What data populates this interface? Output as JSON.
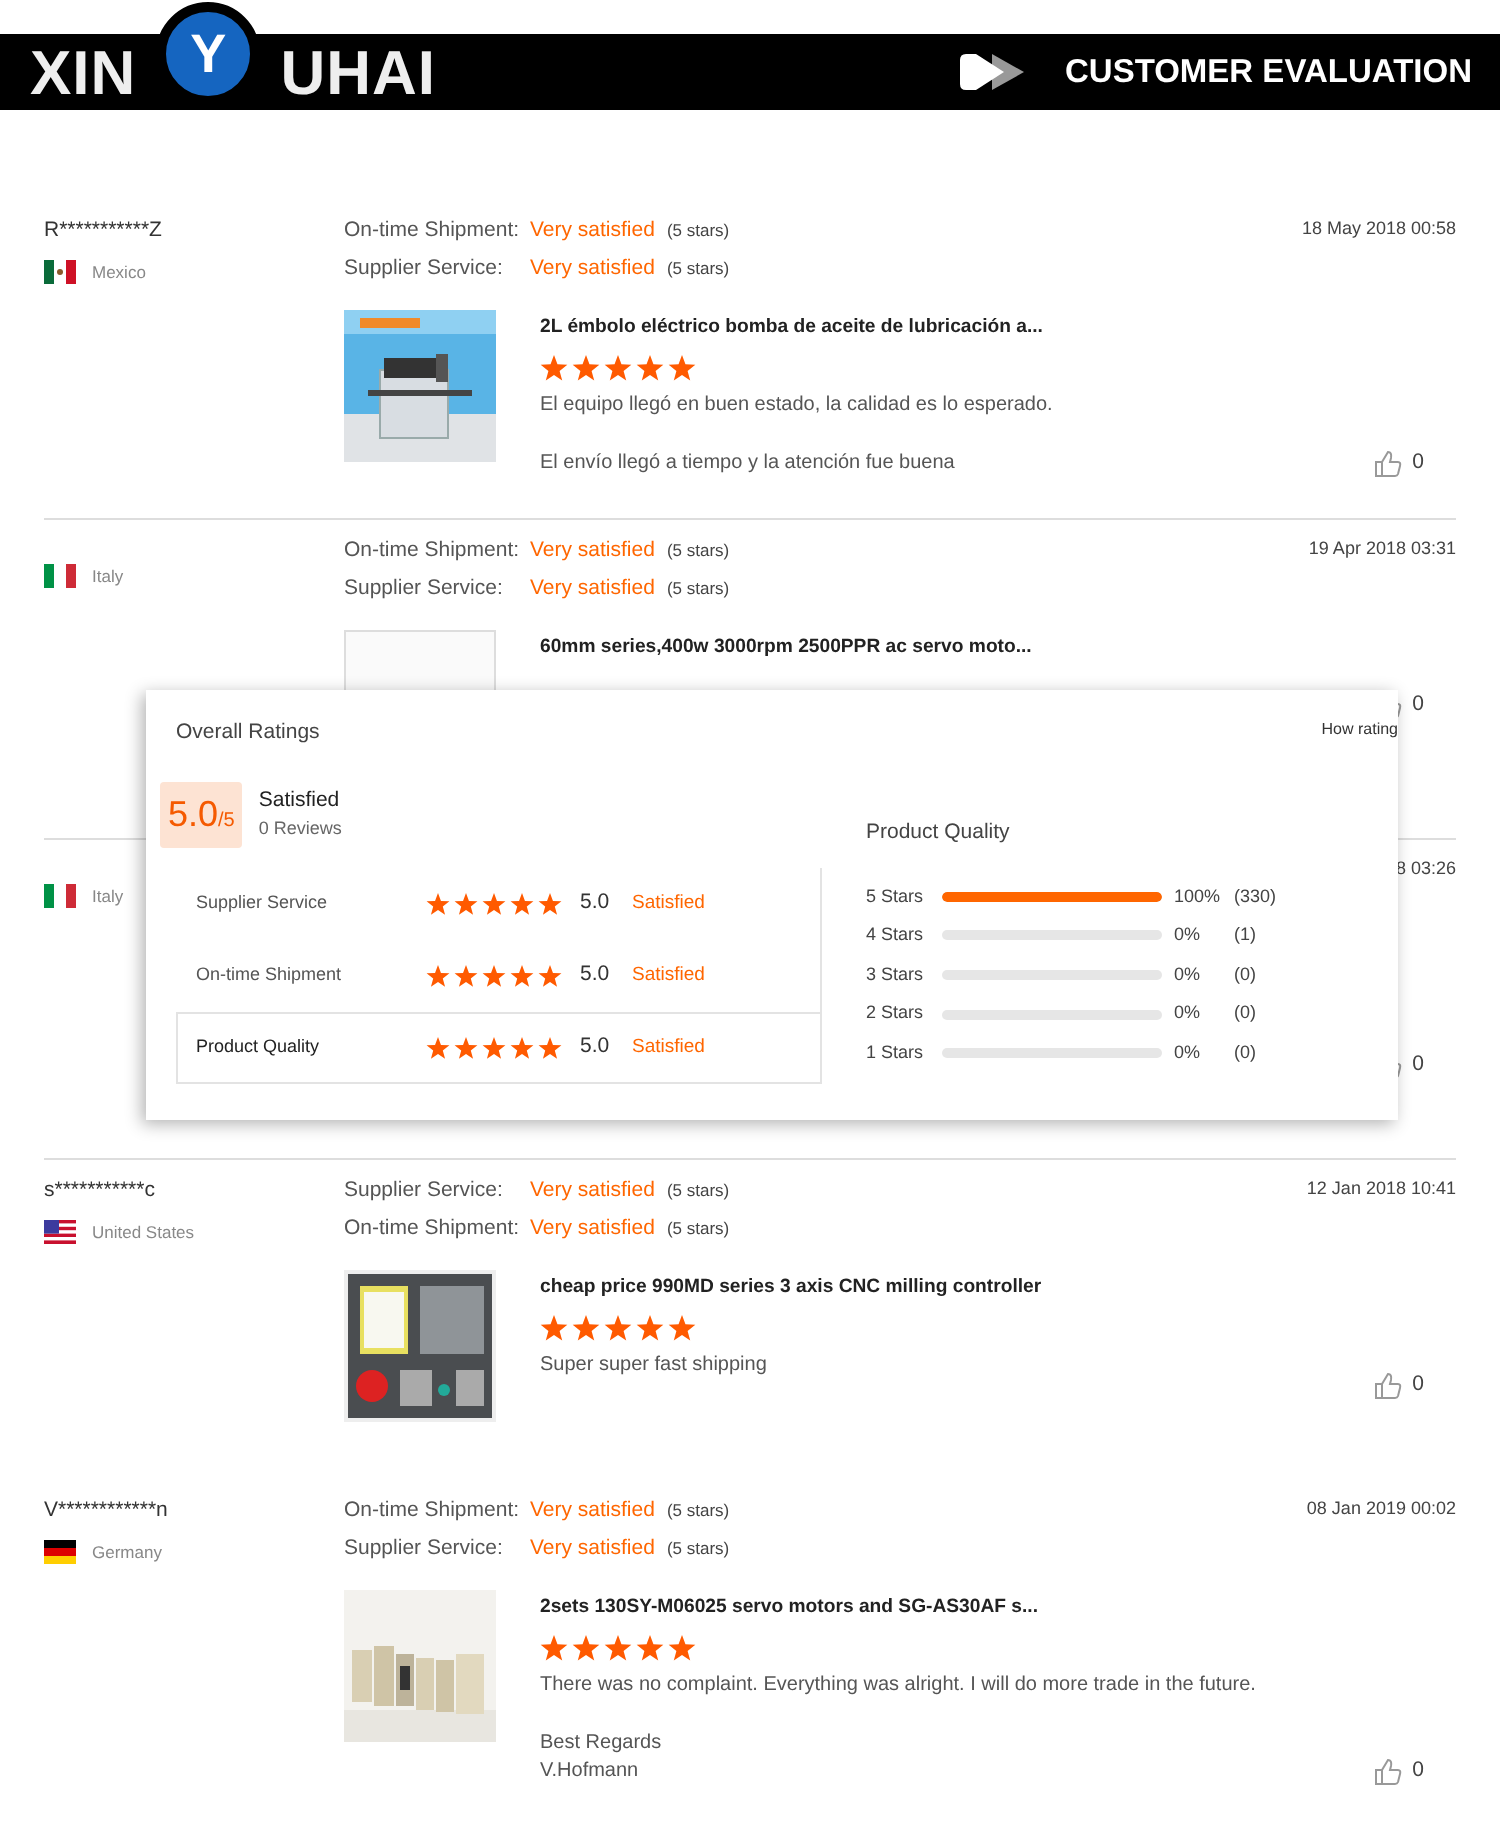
{
  "header": {
    "brand_left": "XIN",
    "brand_mark": "Y",
    "brand_right": "UHAI",
    "title": "CUSTOMER EVALUATION"
  },
  "reviews": [
    {
      "name": "R***********Z",
      "flag": {
        "kind": "mexico"
      },
      "country": "Mexico",
      "date": "18 May 2018 00:58",
      "ratings": [
        {
          "label": "On-time Shipment:",
          "value": "Very satisfied",
          "note": "(5 stars)"
        },
        {
          "label": "Supplier Service:",
          "value": "Very satisfied",
          "note": "(5 stars)"
        }
      ],
      "product": {
        "thumbnail": {
          "kind": "picture"
        },
        "title": "2L émbolo eléctrico bomba de aceite de lubricación a...",
        "stars": 5,
        "comments": [
          "El equipo llegó en buen estado, la calidad es lo esperado.",
          "El envío llegó a tiempo y la atención fue buena"
        ]
      },
      "likes": "0",
      "divider_below": true
    },
    {
      "flag": {
        "kind": "italy"
      },
      "country": "Italy",
      "date": "19 Apr 2018 03:31",
      "ratings": [
        {
          "label": "On-time Shipment:",
          "value": "Very satisfied",
          "note": "(5 stars)"
        },
        {
          "label": "Supplier Service:",
          "value": "Very satisfied",
          "note": "(5 stars)"
        }
      ],
      "product": {
        "thumbnail": {
          "kind": "picture"
        },
        "title": "60mm series,400w 3000rpm 2500PPR ac servo moto..."
      },
      "likes": "0",
      "divider_below": true
    },
    {
      "flag": {
        "kind": "italy"
      },
      "country": "Italy",
      "date": "8 03:26",
      "likes": "0",
      "divider_below": true
    },
    {
      "name": "s***********c",
      "flag": {
        "kind": "usa"
      },
      "country": "United States",
      "date": "12 Jan 2018 10:41",
      "ratings": [
        {
          "label": "Supplier Service:",
          "value": "Very satisfied",
          "note": "(5 stars)"
        },
        {
          "label": "On-time Shipment:",
          "value": "Very satisfied",
          "note": "(5 stars)"
        }
      ],
      "product": {
        "thumbnail": {
          "kind": "picture"
        },
        "title": "cheap price 990MD series 3 axis CNC milling controller",
        "stars": 5,
        "comments": [
          "Super super fast shipping"
        ]
      },
      "likes": "0",
      "divider_below": false
    },
    {
      "name": "V************n",
      "flag": {
        "kind": "germany"
      },
      "country": "Germany",
      "date": "08 Jan 2019 00:02",
      "ratings": [
        {
          "label": "On-time Shipment:",
          "value": "Very satisfied",
          "note": "(5 stars)"
        },
        {
          "label": "Supplier Service:",
          "value": "Very satisfied",
          "note": "(5 stars)"
        }
      ],
      "product": {
        "thumbnail": {
          "kind": "picture"
        },
        "title": "2sets 130SY-M06025 servo motors and SG-AS30AF s...",
        "stars": 5,
        "comments": [
          "There was no complaint. Everything was alright. I will do more trade in the future.",
          "Best Regards\nV.Hofmann"
        ]
      },
      "likes": "0",
      "divider_below": false
    }
  ],
  "rating_popup": {
    "title": "Overall Ratings",
    "help_link": "How rating",
    "score": "5.0",
    "score_max": "/5",
    "verdict": "Satisfied",
    "reviews": "0 Reviews",
    "categories": [
      {
        "label": "Supplier Service",
        "stars": 5,
        "score": "5.0",
        "verdict": "Satisfied",
        "selected": false
      },
      {
        "label": "On-time Shipment",
        "stars": 5,
        "score": "5.0",
        "verdict": "Satisfied",
        "selected": false
      },
      {
        "label": "Product Quality",
        "stars": 5,
        "score": "5.0",
        "verdict": "Satisfied",
        "selected": true
      }
    ],
    "breakdown": {
      "title": "Product Quality",
      "rows": [
        {
          "label": "5  Stars",
          "level": 1,
          "percent": "100%",
          "count": "(330)"
        },
        {
          "label": "4  Stars",
          "level": 0,
          "percent": "0%",
          "count": "(1)"
        },
        {
          "label": "3  Stars",
          "level": 0,
          "percent": "0%",
          "count": "(0)"
        },
        {
          "label": "2  Stars",
          "level": 0,
          "percent": "0%",
          "count": "(0)"
        },
        {
          "label": "1  Stars",
          "level": 0,
          "percent": "0%",
          "count": "(0)"
        }
      ]
    }
  }
}
